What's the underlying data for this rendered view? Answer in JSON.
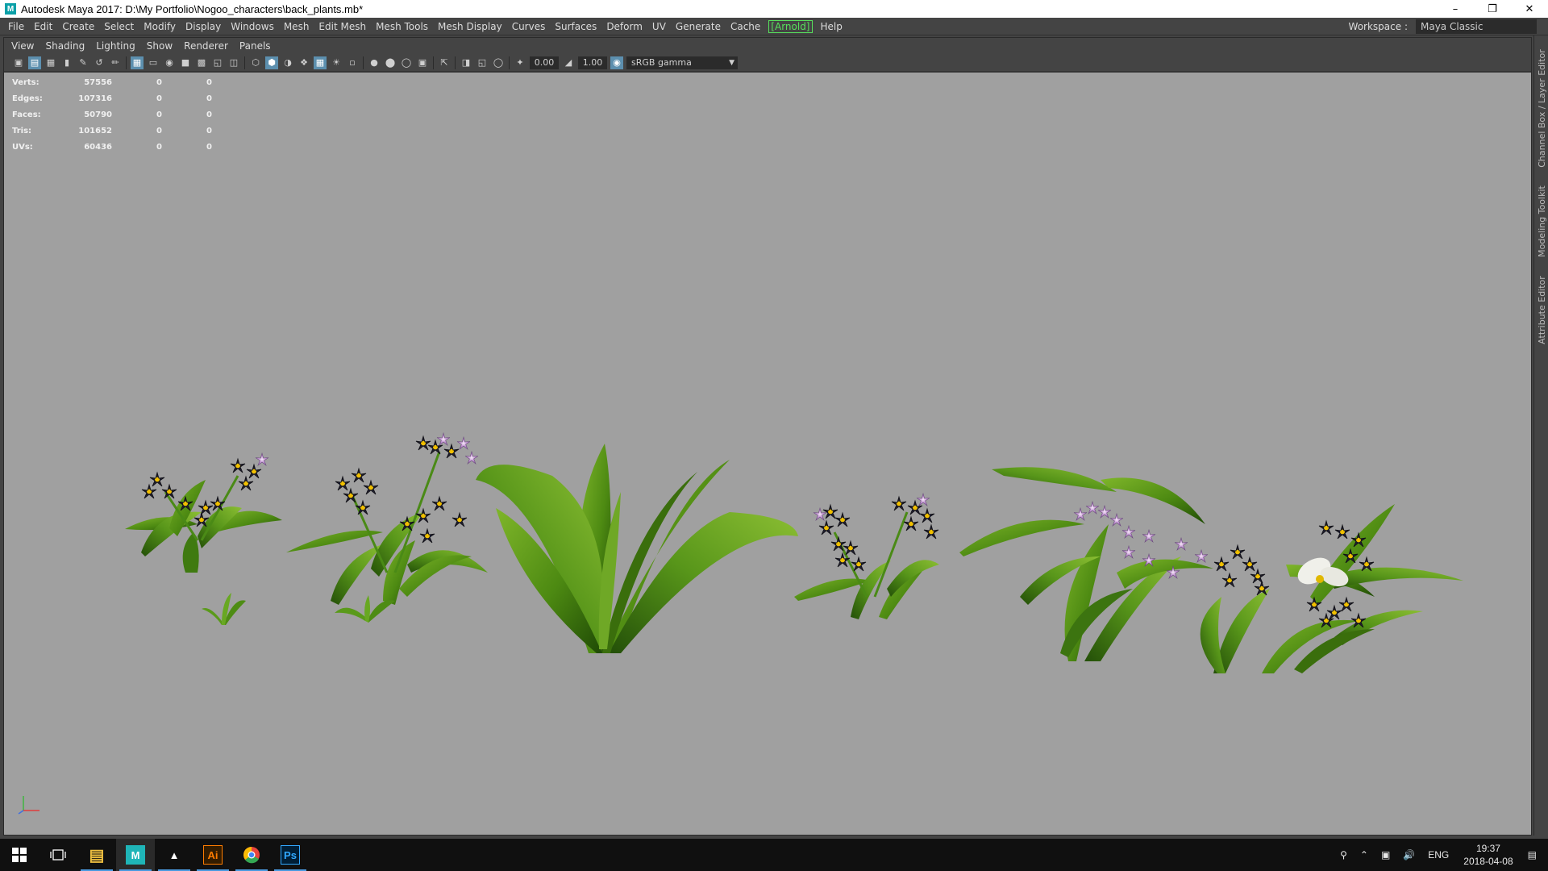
{
  "window": {
    "title": "Autodesk Maya 2017: D:\\My Portfolio\\Nogoo_characters\\back_plants.mb*",
    "app_icon_letter": "M",
    "minimize": "–",
    "restore": "❐",
    "close": "✕"
  },
  "main_menu": [
    "File",
    "Edit",
    "Create",
    "Select",
    "Modify",
    "Display",
    "Windows",
    "Mesh",
    "Edit Mesh",
    "Mesh Tools",
    "Mesh Display",
    "Curves",
    "Surfaces",
    "Deform",
    "UV",
    "Generate",
    "Cache",
    "[Arnold]",
    "Help"
  ],
  "workspace": {
    "label": "Workspace :",
    "value": "Maya Classic"
  },
  "panel_menu": [
    "View",
    "Shading",
    "Lighting",
    "Show",
    "Renderer",
    "Panels"
  ],
  "panel_toolbar": {
    "exposure": "0.00",
    "gamma": "1.00",
    "color_space": "sRGB gamma"
  },
  "hud": [
    {
      "label": "Verts:",
      "value": "57556",
      "sel": "0",
      "comp": "0"
    },
    {
      "label": "Edges:",
      "value": "107316",
      "sel": "0",
      "comp": "0"
    },
    {
      "label": "Faces:",
      "value": "50790",
      "sel": "0",
      "comp": "0"
    },
    {
      "label": "Tris:",
      "value": "101652",
      "sel": "0",
      "comp": "0"
    },
    {
      "label": "UVs:",
      "value": "60436",
      "sel": "0",
      "comp": "0"
    }
  ],
  "dock_tabs": [
    "Channel Box / Layer Editor",
    "Modeling Toolkit",
    "Attribute Editor"
  ],
  "taskbar": {
    "apps": [
      {
        "name": "File Explorer",
        "glyph": "▤",
        "color": "#f0c040"
      },
      {
        "name": "Maya",
        "glyph": "M",
        "color": "#1fb5b8"
      },
      {
        "name": "Photos",
        "glyph": "▲",
        "color": "#ffffff"
      },
      {
        "name": "Illustrator",
        "glyph": "Ai",
        "color": "#ff7c00"
      },
      {
        "name": "Chrome",
        "glyph": "●",
        "color": "#e8453c"
      },
      {
        "name": "Photoshop",
        "glyph": "Ps",
        "color": "#31a8ff"
      }
    ],
    "language": "ENG",
    "time": "19:37",
    "date": "2018-04-08"
  }
}
